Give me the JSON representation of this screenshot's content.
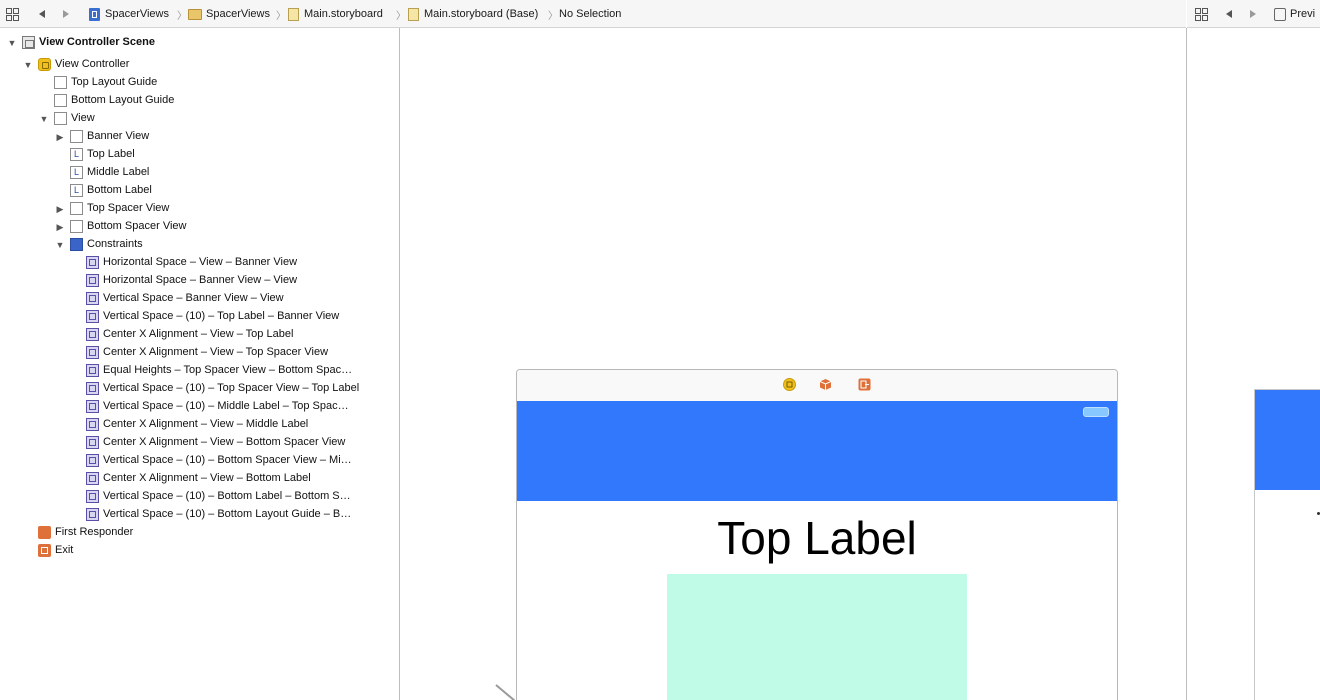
{
  "jump_bar": {
    "crumbs": [
      "SpacerViews",
      "SpacerViews",
      "Main.storyboard",
      "Main.storyboard (Base)",
      "No Selection"
    ],
    "separator": "〉"
  },
  "preview_bar": {
    "label": "Previ"
  },
  "outline": {
    "scene": "View Controller Scene",
    "view_controller": "View Controller",
    "top_layout_guide": "Top Layout Guide",
    "bottom_layout_guide": "Bottom Layout Guide",
    "view": "View",
    "subviews": [
      "Banner View",
      "Top Label",
      "Middle Label",
      "Bottom Label",
      "Top Spacer View",
      "Bottom Spacer View"
    ],
    "constraints_label": "Constraints",
    "constraints": [
      "Horizontal Space – View – Banner View",
      "Horizontal Space – Banner View – View",
      "Vertical Space – Banner View – View",
      "Vertical Space – (10) – Top Label – Banner View",
      "Center X Alignment – View – Top Label",
      "Center X Alignment – View – Top Spacer View",
      "Equal Heights – Top Spacer View – Bottom Spac…",
      "Vertical Space – (10) – Top Spacer View – Top Label",
      "Vertical Space – (10) – Middle Label – Top Spac…",
      "Center X Alignment – View – Middle Label",
      "Center X Alignment – View – Bottom Spacer View",
      "Vertical Space – (10) – Bottom Spacer View – Mi…",
      "Center X Alignment – View – Bottom Label",
      "Vertical Space – (10) – Bottom Label – Bottom S…",
      "Vertical Space – (10) – Bottom Layout Guide – B…"
    ],
    "first_responder": "First Responder",
    "exit": "Exit"
  },
  "canvas": {
    "top_label_text": "Top Label",
    "banner_color": "#3178fc",
    "spacer_color": "#c0fbe8"
  }
}
